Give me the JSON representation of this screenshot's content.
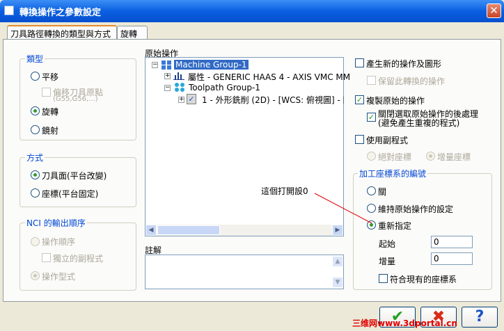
{
  "window": {
    "title": "轉換操作之參數設定",
    "close_label": "✕"
  },
  "tabs": [
    {
      "label": "刀具路徑轉換的類型與方式"
    },
    {
      "label": "旋轉"
    }
  ],
  "type_group": {
    "title": "類型",
    "options": [
      {
        "label": "平移"
      },
      {
        "label": "旋轉"
      },
      {
        "label": "鏡射"
      }
    ],
    "offset_checkbox": {
      "line1": "偏移刀具原點",
      "line2": "(G55,G56,...)"
    }
  },
  "method_group": {
    "title": "方式",
    "options": [
      {
        "label": "刀具面(平台改變)"
      },
      {
        "label": "座標(平台固定)"
      }
    ]
  },
  "nci_group": {
    "title": "NCI 的輸出順序",
    "options": [
      {
        "label": "操作順序"
      },
      {
        "label": "操作型式"
      }
    ],
    "sub_checkbox": "獨立的副程式"
  },
  "source_ops": {
    "title": "原始操作",
    "tree": {
      "machine_group": "Machine Group-1",
      "properties": "屬性 - GENERIC HAAS 4 - AXIS VMC MM",
      "toolpath_group": "Toolpath Group-1",
      "operation": "1 - 外形銑削 (2D) - [WCS: 俯視圖] - [刀具"
    }
  },
  "comments": {
    "title": "註解",
    "value": ""
  },
  "right": {
    "create_new": "產生新的操作及圖形",
    "keep_transform": "保留此轉換的操作",
    "copy_original": "複製原始的操作",
    "disable_post_line1": "關閉選取原始操作的後處理",
    "disable_post_line2": "(避免產生重複的程式)",
    "use_subprogram": "使用副程式",
    "absolute": "絕對座標",
    "incremental": "增量座標"
  },
  "wcs_group": {
    "title": "加工座標系的編號",
    "options": [
      {
        "label": "關"
      },
      {
        "label": "維持原始操作的設定"
      },
      {
        "label": "重新指定"
      }
    ],
    "start_label": "起始",
    "start_value": "0",
    "increment_label": "增量",
    "increment_value": "0",
    "match_existing": "符合現有的座標系"
  },
  "annotation": "這個打開設0",
  "buttons": {
    "ok": "✔",
    "cancel": "✖",
    "help": "?"
  },
  "watermark": "三维网www.3dportal.cn",
  "colors": {
    "title_bar": "#0a5fe0",
    "group_title": "#0046d5",
    "annotation_line": "#e00000",
    "watermark": "#e00000"
  }
}
